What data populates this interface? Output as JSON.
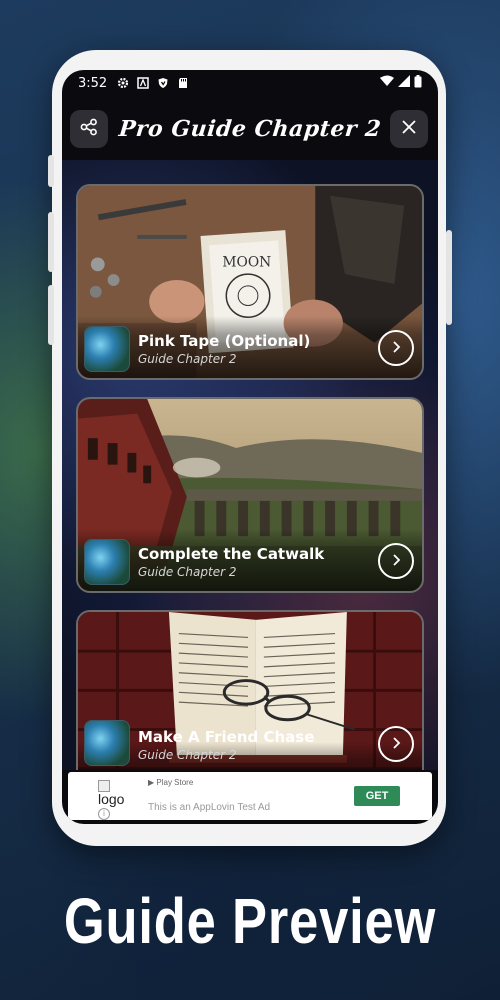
{
  "status_bar": {
    "time": "3:52",
    "icons": [
      "gear-icon",
      "a-badge-icon",
      "shield-icon",
      "sd-card-icon"
    ],
    "right_icons": [
      "wifi-icon",
      "signal-icon",
      "battery-icon"
    ]
  },
  "app_bar": {
    "title": "Pro Guide Chapter 2",
    "left_icon": "share-icon",
    "right_icon": "close-icon"
  },
  "cards": [
    {
      "title": "Pink Tape (Optional)",
      "subtitle": "Guide Chapter 2",
      "scene": "desk-moon-book"
    },
    {
      "title": "Complete the Catwalk",
      "subtitle": "Guide Chapter 2",
      "scene": "train-viaduct"
    },
    {
      "title": "Make A Friend Chase",
      "subtitle": "Guide Chapter 2",
      "scene": "open-book-glasses"
    }
  ],
  "ad": {
    "logo_alt": "logo",
    "store": "Play Store",
    "text": "This is an AppLovin Test Ad",
    "cta": "GET"
  },
  "caption": "Guide Preview",
  "colors": {
    "cta_green": "#2e8b57",
    "screen_bg": "#0b0b0f",
    "phone_frame": "#f3f3f3"
  }
}
